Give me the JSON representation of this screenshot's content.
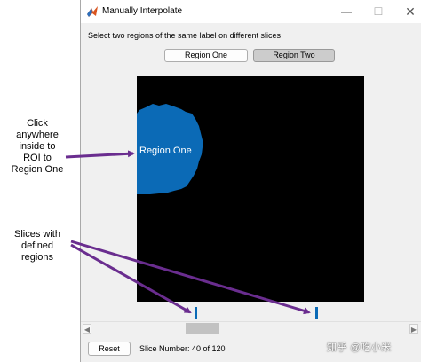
{
  "window": {
    "title": "Manually Interpolate"
  },
  "dialog": {
    "instruction": "Select two regions of the same label on different slices",
    "tabs": [
      {
        "label": "Region One",
        "selected": false
      },
      {
        "label": "Region Two",
        "selected": true
      }
    ],
    "image": {
      "region_label": "Region One",
      "region_color": "#0b6ab6",
      "background_color": "#000000"
    },
    "reset_label": "Reset",
    "slice_label": "Slice Number: 40 of 120"
  },
  "annotations": {
    "click_note_lines": [
      "Click",
      "anywhere",
      "inside to",
      "ROI to",
      "Region One"
    ],
    "slices_note_lines": [
      "Slices with",
      "defined",
      "regions"
    ],
    "arrow_color": "#6a2d8f"
  },
  "watermark": "知乎 @吃小米"
}
